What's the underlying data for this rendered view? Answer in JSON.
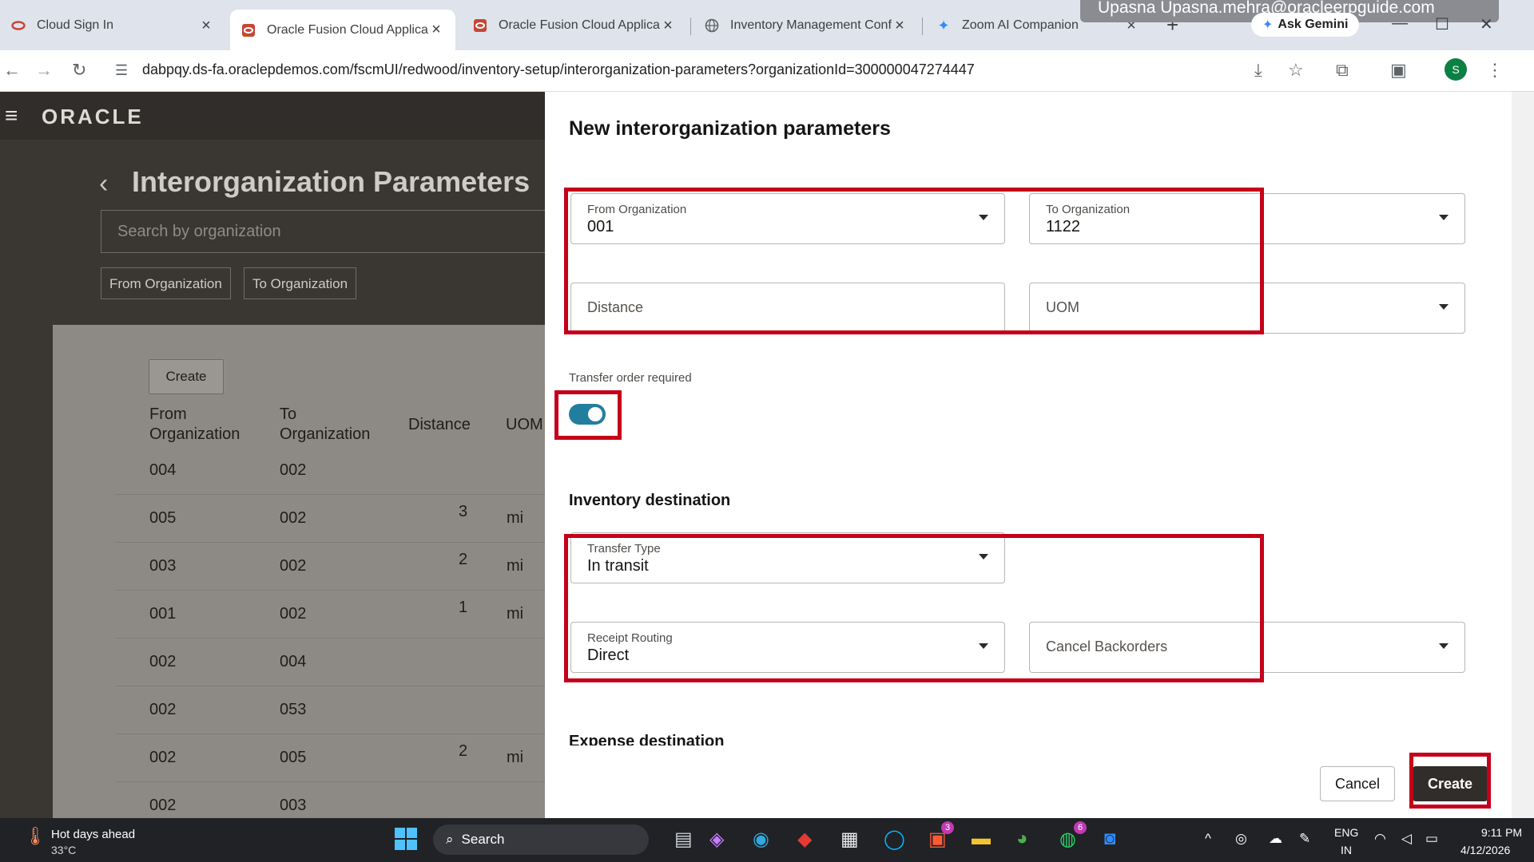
{
  "browser": {
    "tabs": [
      {
        "title": "Cloud Sign In",
        "active": false
      },
      {
        "title": "Oracle Fusion Cloud Applicatic",
        "active": true
      },
      {
        "title": "Oracle Fusion Cloud Applicatic",
        "active": false
      },
      {
        "title": "Inventory Management Config",
        "active": false
      },
      {
        "title": "Zoom AI Companion",
        "active": false
      }
    ],
    "ask_gemini": "Ask Gemini",
    "profile_banner": "Upasna Upasna.mehra@oracleerpguide.com",
    "url": "dabpqy.ds-fa.oraclepdemos.com/fscmUI/redwood/inventory-setup/interorganization-parameters?organizationId=300000047274447",
    "avatar_letter": "S"
  },
  "app": {
    "logo": "ORACLE",
    "page_title": "Interorganization Parameters",
    "search_placeholder": "Search by organization",
    "filter_chips": [
      "From Organization",
      "To Organization"
    ],
    "create_label": "Create",
    "table": {
      "headers": {
        "from": "From\nOrganization",
        "to": "To\nOrganization",
        "distance": "Distance",
        "uom": "UOM"
      },
      "rows": [
        {
          "from": "004",
          "to": "002",
          "distance": "",
          "uom": ""
        },
        {
          "from": "005",
          "to": "002",
          "distance": "3",
          "uom": "mi"
        },
        {
          "from": "003",
          "to": "002",
          "distance": "2",
          "uom": "mi"
        },
        {
          "from": "001",
          "to": "002",
          "distance": "1",
          "uom": "mi"
        },
        {
          "from": "002",
          "to": "004",
          "distance": "",
          "uom": ""
        },
        {
          "from": "002",
          "to": "053",
          "distance": "",
          "uom": ""
        },
        {
          "from": "002",
          "to": "005",
          "distance": "2",
          "uom": "mi"
        },
        {
          "from": "002",
          "to": "003",
          "distance": "",
          "uom": ""
        }
      ]
    }
  },
  "drawer": {
    "title": "New interorganization parameters",
    "from_org": {
      "label": "From Organization",
      "value": "001"
    },
    "to_org": {
      "label": "To Organization",
      "value": "1122"
    },
    "distance": {
      "placeholder": "Distance"
    },
    "uom": {
      "placeholder": "UOM"
    },
    "transfer_order": {
      "label": "Transfer order required",
      "on": true
    },
    "inventory_destination": "Inventory destination",
    "transfer_type": {
      "label": "Transfer Type",
      "value": "In transit"
    },
    "receipt_routing": {
      "label": "Receipt Routing",
      "value": "Direct"
    },
    "cancel_backorders": {
      "placeholder": "Cancel Backorders"
    },
    "expense_destination": "Expense destination",
    "cancel_label": "Cancel",
    "create_label": "Create"
  },
  "taskbar": {
    "weather_title": "Hot days ahead",
    "weather_temp": "33°C",
    "search": "Search",
    "lang1": "ENG",
    "lang2": "IN",
    "time": "9:11 PM",
    "date": "4/12/2026",
    "badges": {
      "app_l": "3",
      "whatsapp": "6"
    }
  },
  "colors": {
    "accent": "#227e9e",
    "highlight": "#c4001a",
    "primary_button": "#312d2a"
  }
}
